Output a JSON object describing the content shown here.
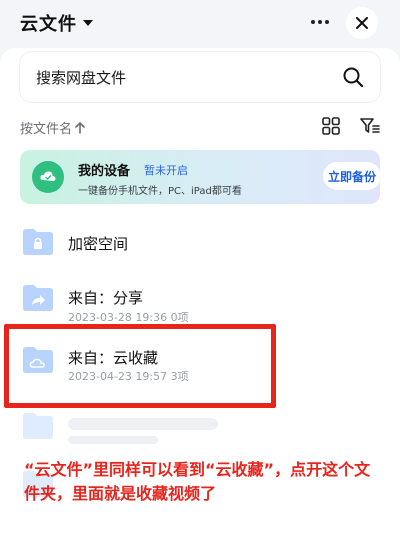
{
  "header": {
    "title": "云文件"
  },
  "search": {
    "placeholder": "搜索网盘文件"
  },
  "sort": {
    "label": "按文件名"
  },
  "device_card": {
    "title": "我的设备",
    "status": "暂未开启",
    "subtitle": "一键备份手机文件，PC、iPad都可看",
    "button": "立即备份"
  },
  "files": [
    {
      "name": "加密空间",
      "meta": "",
      "icon": "lock-icon"
    },
    {
      "name": "来自：分享",
      "meta": "2023-03-28 19:36  0项",
      "icon": "share-icon"
    },
    {
      "name": "来自：云收藏",
      "meta": "2023-04-23 19:57  3项",
      "icon": "cloud-icon"
    }
  ],
  "annotation": {
    "text": "“云文件”里同样可以看到“云收藏”，点开这个文件夹，里面就是收藏视频了"
  },
  "colors": {
    "folder": "#b9d3ff",
    "accent": "#1d5fe3",
    "annotation": "#e8251d"
  }
}
